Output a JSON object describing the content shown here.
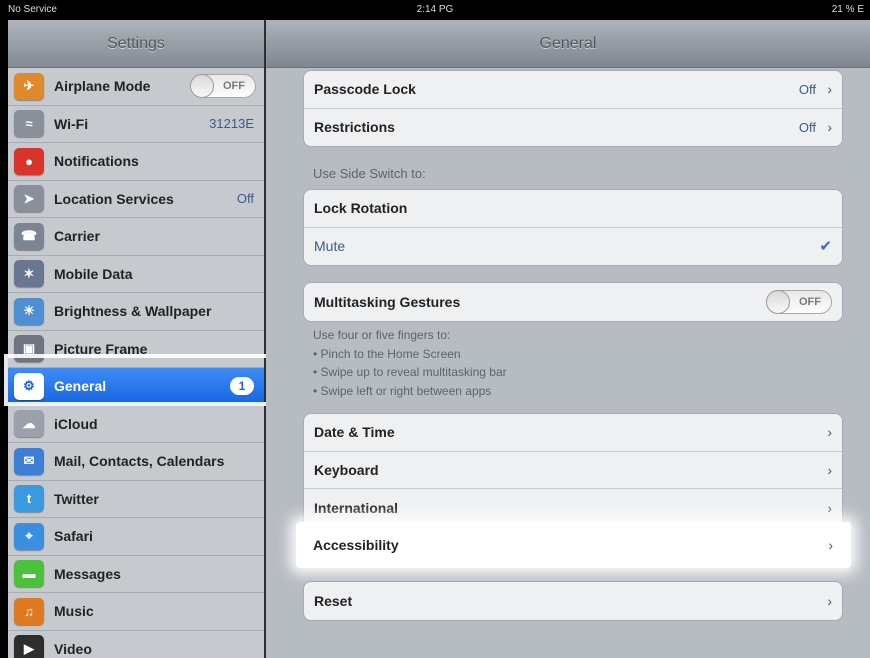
{
  "status": {
    "carrier": "No Service",
    "time": "2:14 PG",
    "battery": "21 % E"
  },
  "sidebar": {
    "title": "Settings",
    "items": [
      {
        "label": "Airplane Mode",
        "icon": "airplane-icon",
        "color": "#e0892a",
        "toggle": "OFF"
      },
      {
        "label": "Wi-Fi",
        "icon": "wifi-icon",
        "color": "#8a9099",
        "value": "31213E"
      },
      {
        "label": "Notifications",
        "icon": "notifications-icon",
        "color": "#d9342b"
      },
      {
        "label": "Location Services",
        "icon": "location-icon",
        "color": "#8a9099",
        "value": "Off"
      },
      {
        "label": "Carrier",
        "icon": "phone-icon",
        "color": "#7c8591"
      },
      {
        "label": "Mobile Data",
        "icon": "mobile-data-icon",
        "color": "#6a7690"
      },
      {
        "label": "Brightness & Wallpaper",
        "icon": "brightness-icon",
        "color": "#4f8fd1"
      },
      {
        "label": "Picture Frame",
        "icon": "picture-frame-icon",
        "color": "#6e7580"
      },
      {
        "label": "General",
        "icon": "gear-icon",
        "color": "#ffffff",
        "badge": "1"
      },
      {
        "label": "iCloud",
        "icon": "cloud-icon",
        "color": "#9aa1aa"
      },
      {
        "label": "Mail, Contacts, Calendars",
        "icon": "mail-icon",
        "color": "#3e7fd6"
      },
      {
        "label": "Twitter",
        "icon": "twitter-icon",
        "color": "#3a9ae0"
      },
      {
        "label": "Safari",
        "icon": "safari-icon",
        "color": "#3a8fe0"
      },
      {
        "label": "Messages",
        "icon": "messages-icon",
        "color": "#4cc13c"
      },
      {
        "label": "Music",
        "icon": "music-icon",
        "color": "#e07a21"
      },
      {
        "label": "Video",
        "icon": "video-icon",
        "color": "#2d2d2d"
      }
    ]
  },
  "general": {
    "title": "General",
    "passcode_lock": {
      "label": "Passcode Lock",
      "value": "Off"
    },
    "restrictions": {
      "label": "Restrictions",
      "value": "Off"
    },
    "side_switch_label": "Use Side Switch to:",
    "lock_rotation": "Lock Rotation",
    "mute": "Mute",
    "multitasking": {
      "label": "Multitasking Gestures",
      "toggle": "OFF"
    },
    "notes": [
      "Use four or five fingers to:",
      "• Pinch to the Home Screen",
      "• Swipe up to reveal multitasking bar",
      "• Swipe left or right between apps"
    ],
    "date_time": "Date & Time",
    "keyboard": "Keyboard",
    "international": "International",
    "accessibility": "Accessibility",
    "reset": "Reset"
  }
}
